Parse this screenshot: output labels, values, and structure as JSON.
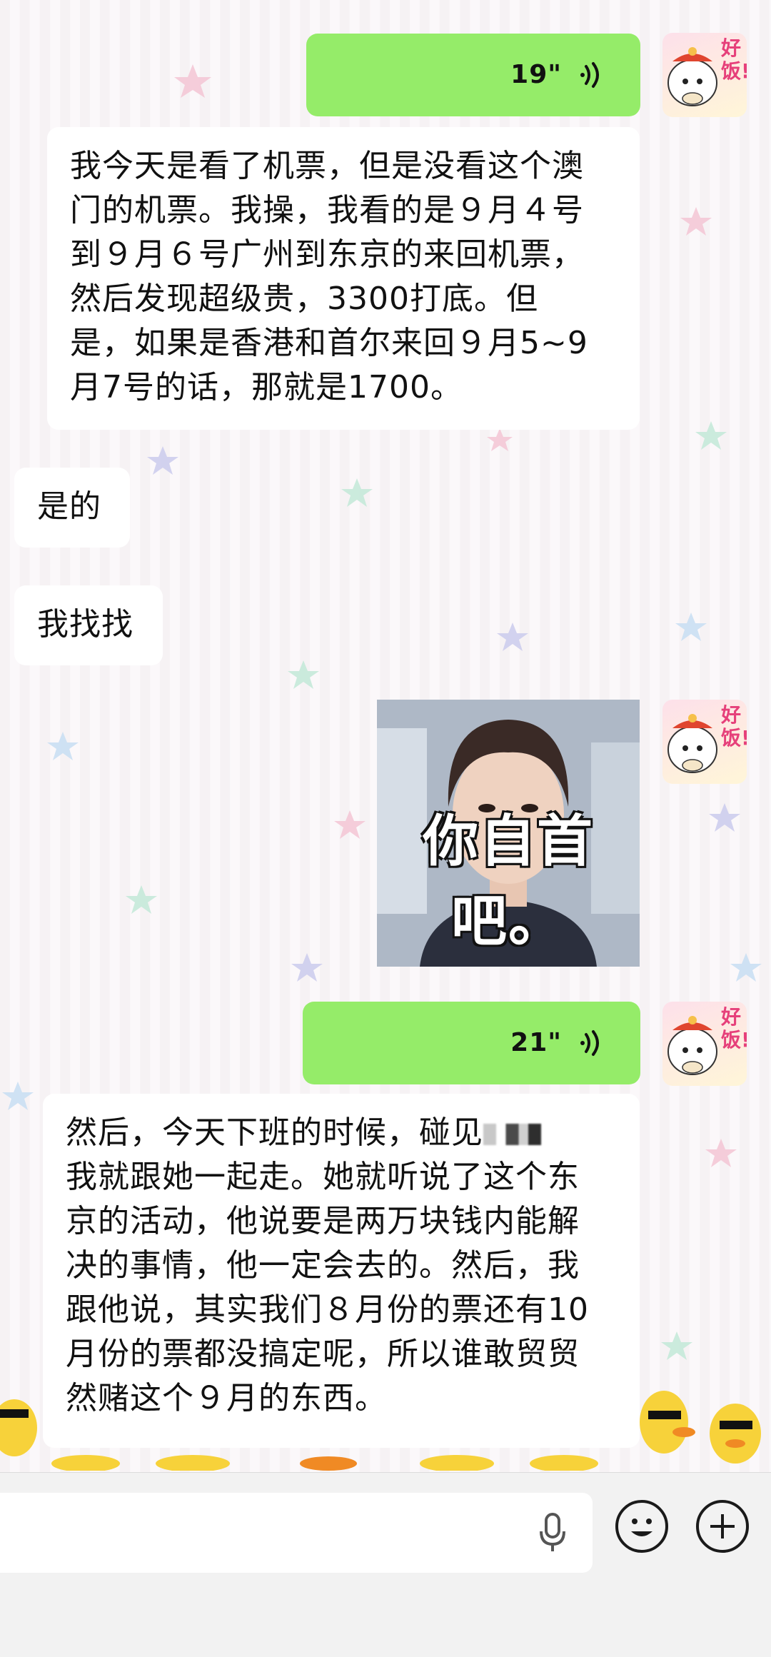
{
  "messages": {
    "voice_1": {
      "duration": "19\""
    },
    "text_1": {
      "lines": [
        "我今天是看了机票，但是没看这个澳",
        "门的机票。我操，我看的是９月４号",
        "到９月６号广州到东京的来回机票，",
        "然后发现超级贵，3300打底。但",
        "是，如果是香港和首尔来回９月5~9",
        "月7号的话，那就是1700。"
      ]
    },
    "text_2": {
      "text": "是的"
    },
    "text_3": {
      "text": "我找找"
    },
    "sticker": {
      "caption": "你自首吧。"
    },
    "voice_2": {
      "duration": "21\""
    },
    "text_4": {
      "line1_start": "然后，今天下班的时候，碰见",
      "lines": [
        "我就跟她一起走。她就听说了这个东",
        "京的活动，他说要是两万块钱内能解",
        "决的事情，他一定会去的。然后，我",
        "跟他说，其实我们８月份的票还有10",
        "月份的票都没搞定呢，所以谁敢贸贸",
        "然赌这个９月的东西。"
      ]
    }
  },
  "avatar": {
    "text": "好饭!"
  },
  "icons": {
    "voice": "voice-wave-icon",
    "mic": "microphone-icon",
    "emoji": "emoji-icon",
    "plus": "plus-icon"
  },
  "colors": {
    "green_bubble": "#95ec69",
    "white_bubble": "#ffffff",
    "input_bar": "#f2f2f2"
  }
}
